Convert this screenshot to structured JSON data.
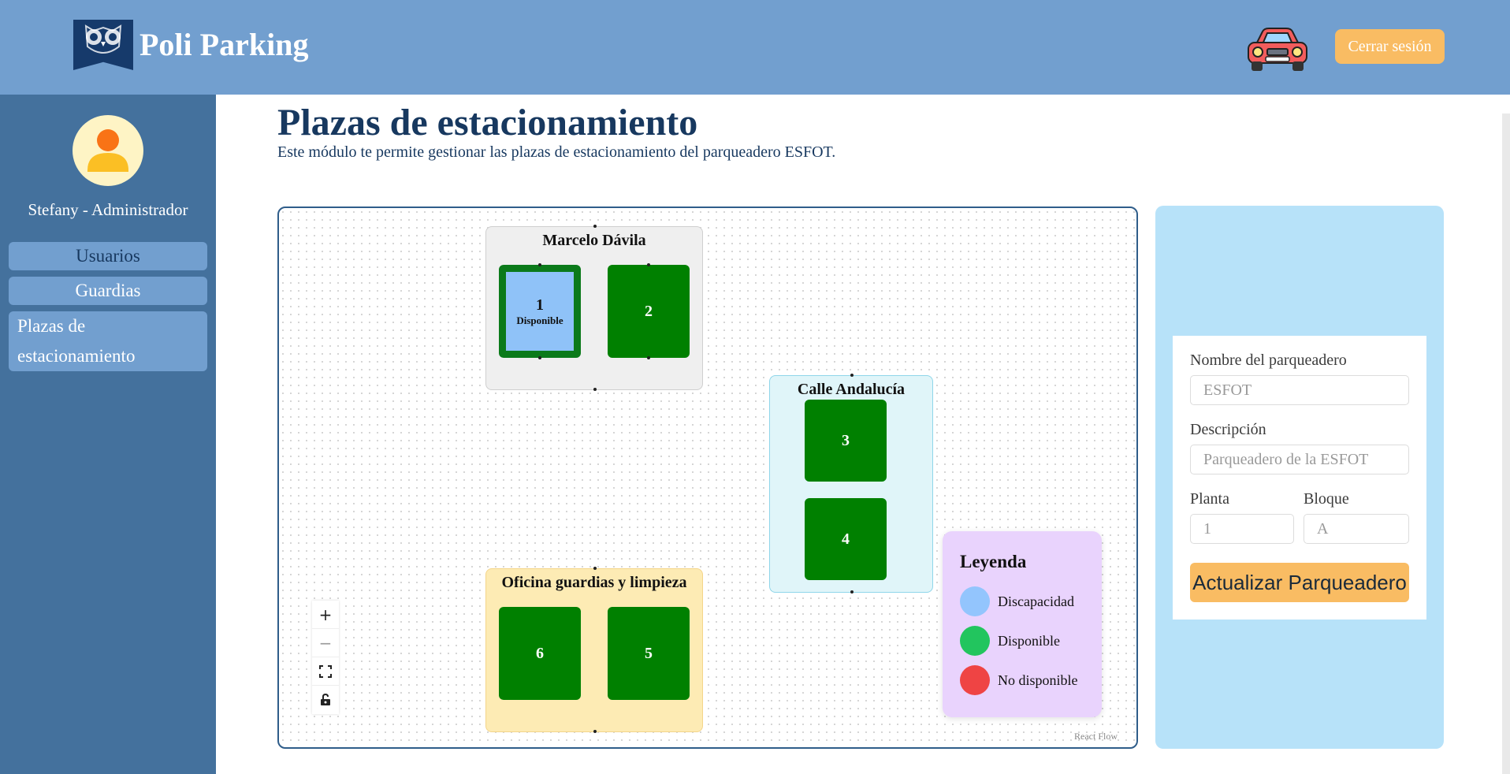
{
  "app": {
    "title": "Poli Parking"
  },
  "header": {
    "logout_label": "Cerrar sesión"
  },
  "user": {
    "name": "Stefany - Administrador"
  },
  "sidebar": {
    "items": [
      {
        "label": "Usuarios"
      },
      {
        "label": "Guardias"
      },
      {
        "label": "Plazas de estacionamiento"
      }
    ]
  },
  "page": {
    "title": "Plazas de estacionamiento",
    "description": "Este módulo te permite gestionar las plazas de estacionamiento del parqueadero ESFOT."
  },
  "flow": {
    "groups": [
      {
        "title": "Marcelo Dávila"
      },
      {
        "title": "Calle Andalucía"
      },
      {
        "title": "Oficina guardias y limpieza"
      }
    ],
    "spots": [
      {
        "number": "1",
        "status": "Disponible"
      },
      {
        "number": "2"
      },
      {
        "number": "3"
      },
      {
        "number": "4"
      },
      {
        "number": "5"
      },
      {
        "number": "6"
      }
    ],
    "legend": {
      "title": "Leyenda",
      "items": [
        {
          "label": "Discapacidad",
          "color": "#93c5fd"
        },
        {
          "label": "Disponible",
          "color": "#22c55e"
        },
        {
          "label": "No disponible",
          "color": "#ef4444"
        }
      ]
    },
    "controls": [
      "zoom-in-icon",
      "zoom-out-icon",
      "fit-view-icon",
      "lock-icon"
    ],
    "attribution": "React Flow"
  },
  "form": {
    "name_label": "Nombre del parqueadero",
    "name_placeholder": "ESFOT",
    "description_label": "Descripción",
    "description_placeholder": "Parqueadero de la ESFOT",
    "floor_label": "Planta",
    "floor_placeholder": "1",
    "block_label": "Bloque",
    "block_placeholder": "A",
    "submit_label": "Actualizar Parqueadero"
  },
  "colors": {
    "header": "#729fcf",
    "sidebar": "#44719d",
    "title": "#17385f",
    "spot": "#008000",
    "accent": "#f9bc63",
    "panel": "#b7e2f9"
  }
}
